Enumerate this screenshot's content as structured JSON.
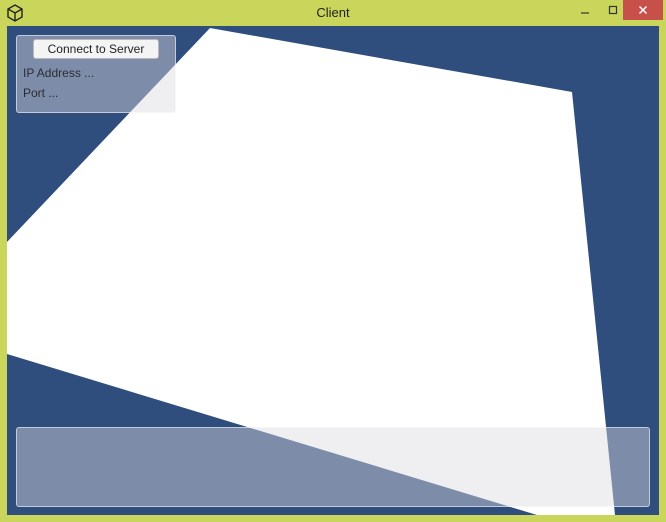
{
  "window": {
    "title": "Client",
    "frame_color": "#c9d55b",
    "close_color": "#c7504b"
  },
  "titlebar": {
    "icons": [
      "unity-logo-icon",
      "minimize-icon",
      "maximize-icon",
      "close-icon"
    ]
  },
  "scene": {
    "background_color": "#304e7d",
    "plane_color": "#ffffff"
  },
  "connection_panel": {
    "connect_label": "Connect to Server",
    "ip_label": "IP Address ...",
    "port_label": "Port ..."
  },
  "console": {
    "text": ""
  }
}
